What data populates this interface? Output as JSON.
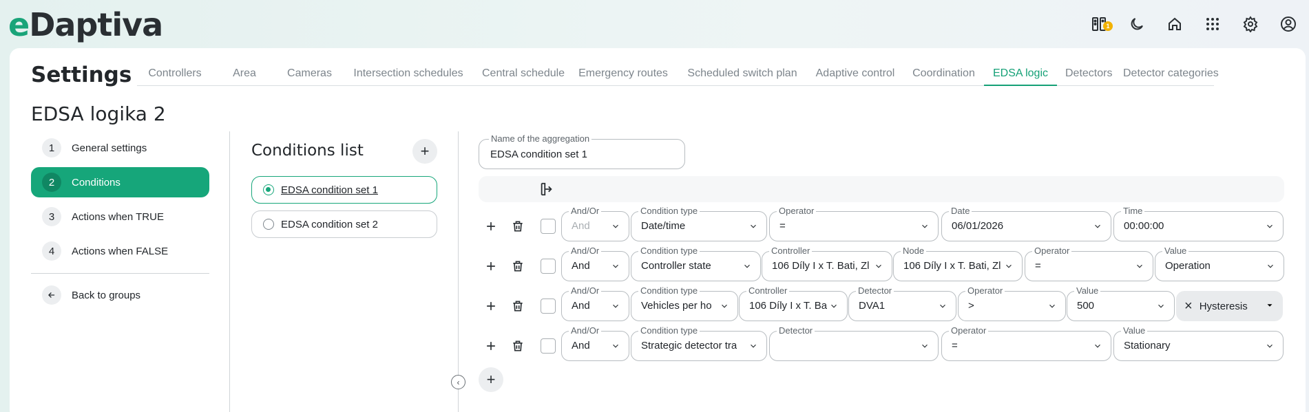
{
  "app": {
    "logo_e": "e",
    "logo_rest": "Daptiva",
    "notification_count": "1"
  },
  "page": {
    "settings_title": "Settings",
    "title": "EDSA logika 2"
  },
  "tabs": [
    "Controllers",
    "Area",
    "Cameras",
    "Intersection schedules",
    "Central schedule",
    "Emergency routes",
    "Scheduled switch plan",
    "Adaptive control",
    "Coordination",
    "EDSA logic",
    "Detectors",
    "Detector categories"
  ],
  "active_tab": "EDSA logic",
  "steps": [
    {
      "num": "1",
      "label": "General settings"
    },
    {
      "num": "2",
      "label": "Conditions"
    },
    {
      "num": "3",
      "label": "Actions when TRUE"
    },
    {
      "num": "4",
      "label": "Actions when FALSE"
    }
  ],
  "back_label": "Back to groups",
  "conditions": {
    "title": "Conditions list",
    "items": [
      "EDSA condition set 1",
      "EDSA condition set 2"
    ]
  },
  "aggregation": {
    "label": "Name of the aggregation",
    "value": "EDSA condition set 1"
  },
  "rows": [
    {
      "fields": [
        {
          "label": "And/Or",
          "value": "And"
        },
        {
          "label": "Condition type",
          "value": "Date/time"
        },
        {
          "label": "Operator",
          "value": "="
        },
        {
          "label": "Date",
          "value": "06/01/2026"
        },
        {
          "label": "Time",
          "value": "00:00:00"
        }
      ]
    },
    {
      "fields": [
        {
          "label": "And/Or",
          "value": "And"
        },
        {
          "label": "Condition type",
          "value": "Controller state"
        },
        {
          "label": "Controller",
          "value": "106 Díly I x T. Bati, Zl"
        },
        {
          "label": "Node",
          "value": "106 Díly I x T. Bati, Zl"
        },
        {
          "label": "Operator",
          "value": "="
        },
        {
          "label": "Value",
          "value": "Operation"
        }
      ]
    },
    {
      "fields": [
        {
          "label": "And/Or",
          "value": "And"
        },
        {
          "label": "Condition type",
          "value": "Vehicles per ho"
        },
        {
          "label": "Controller",
          "value": "106 Díly I x T. Ba"
        },
        {
          "label": "Detector",
          "value": "DVA1"
        },
        {
          "label": "Operator",
          "value": ">"
        },
        {
          "label": "Value",
          "value": "500"
        }
      ],
      "chip": "Hysteresis"
    },
    {
      "fields": [
        {
          "label": "And/Or",
          "value": "And"
        },
        {
          "label": "Condition type",
          "value": "Strategic detector tra"
        },
        {
          "label": "Detector",
          "value": ""
        },
        {
          "label": "Operator",
          "value": "="
        },
        {
          "label": "Value",
          "value": "Stationary"
        }
      ]
    }
  ]
}
